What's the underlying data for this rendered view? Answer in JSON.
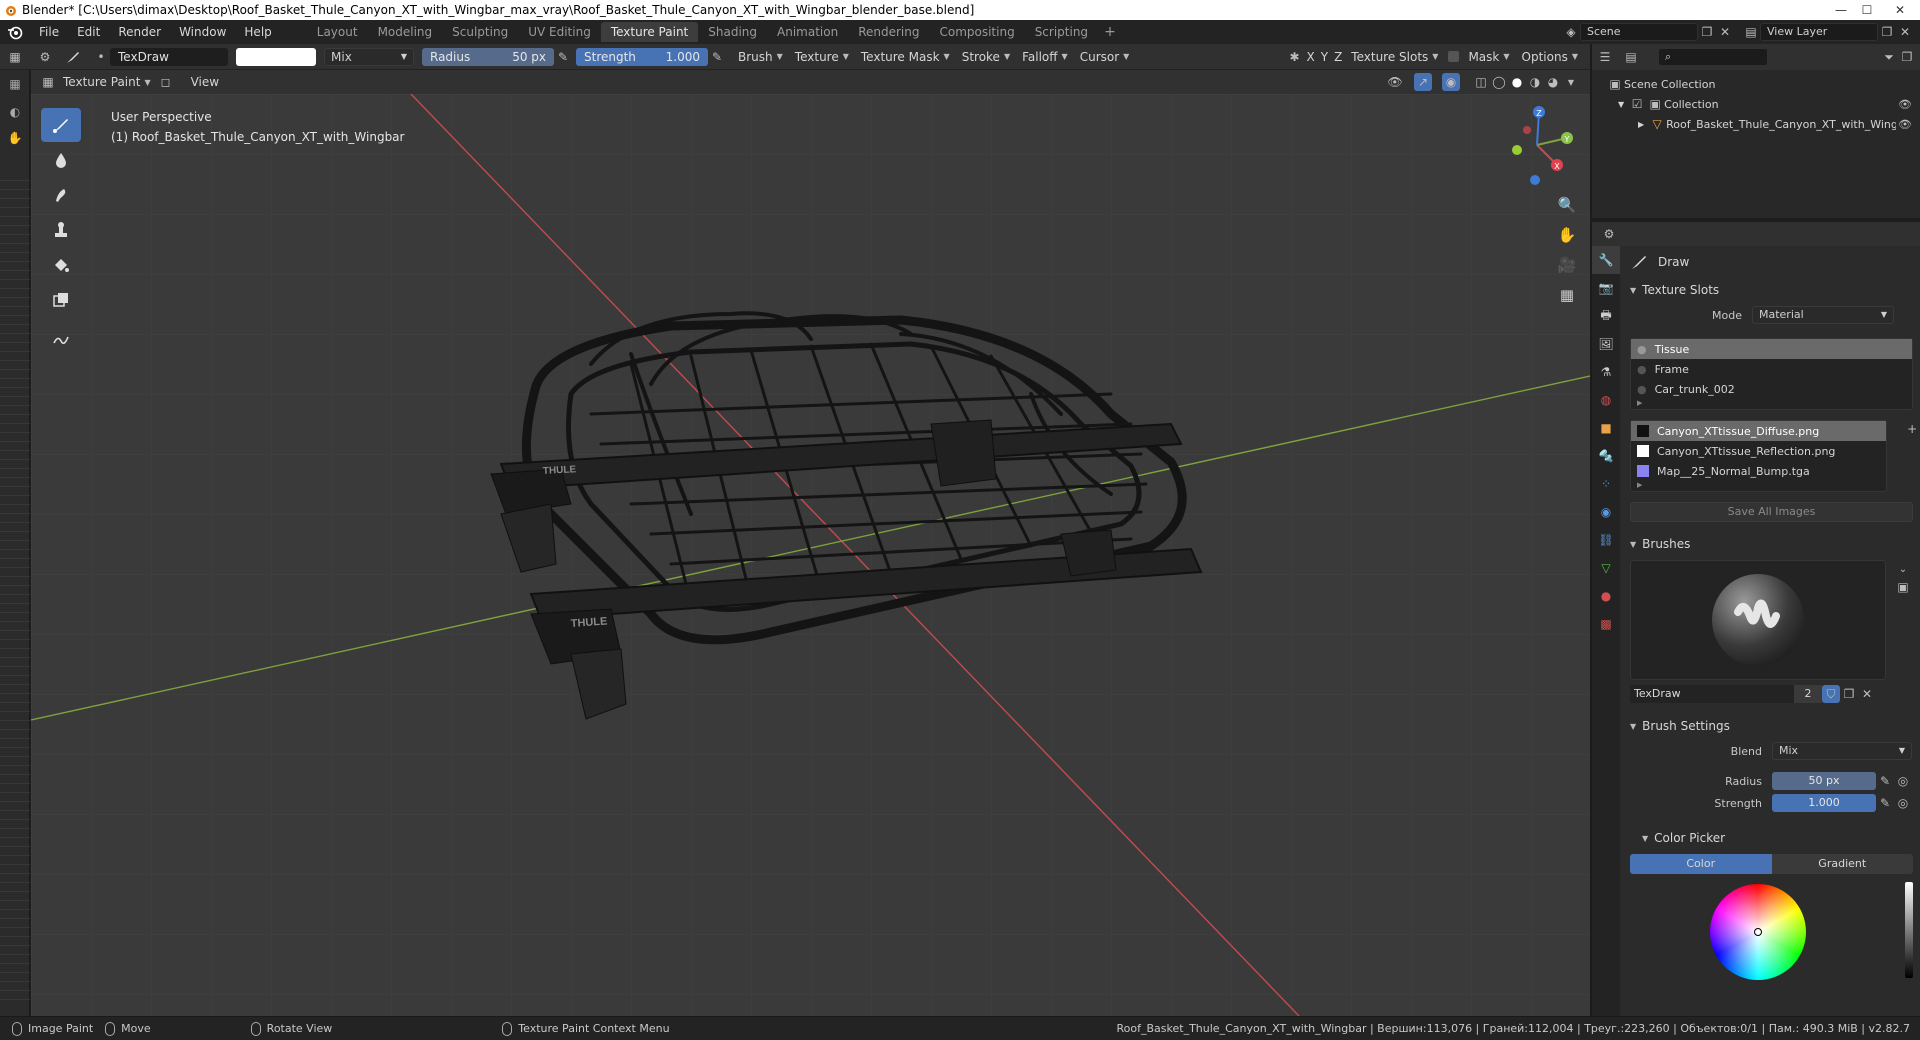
{
  "window": {
    "title": "Blender* [C:\\Users\\dimax\\Desktop\\Roof_Basket_Thule_Canyon_XT_with_Wingbar_max_vray\\Roof_Basket_Thule_Canyon_XT_with_Wingbar_blender_base.blend]",
    "minimize": "—",
    "maximize": "☐",
    "close": "✕"
  },
  "menubar": {
    "menus": [
      "File",
      "Edit",
      "Render",
      "Window",
      "Help"
    ],
    "workspaces": [
      "Layout",
      "Modeling",
      "Sculpting",
      "UV Editing",
      "Texture Paint",
      "Shading",
      "Animation",
      "Rendering",
      "Compositing",
      "Scripting"
    ],
    "active_workspace": "Texture Paint",
    "add_tab": "+",
    "scene": "Scene",
    "view_layer": "View Layer"
  },
  "toolheader": {
    "brush_name": "TexDraw",
    "blend": "Mix",
    "radius_label": "Radius",
    "radius_value": "50 px",
    "strength_label": "Strength",
    "strength_value": "1.000",
    "dropdowns": [
      "Brush",
      "Texture",
      "Texture Mask",
      "Stroke",
      "Falloff",
      "Cursor"
    ],
    "axes": [
      "X",
      "Y",
      "Z"
    ],
    "texture_slots": "Texture Slots",
    "mask": "Mask",
    "options": "Options"
  },
  "viewport": {
    "mode": "Texture Paint",
    "view_menu": "View",
    "perspective": "User Perspective",
    "object_info": "(1) Roof_Basket_Thule_Canyon_XT_with_Wingbar",
    "logo_text": "THULE",
    "gizmo": {
      "x": "X",
      "y": "Y",
      "z": "Z"
    },
    "colors": {
      "background": "#3c3c3c",
      "x_axis": "#c44a4f",
      "y_axis": "#7ea23d",
      "accent": "#4772b3"
    }
  },
  "outliner": {
    "scene_collection": "Scene Collection",
    "collection": "Collection",
    "object": "Roof_Basket_Thule_Canyon_XT_with_Wingbar"
  },
  "properties": {
    "tool_name": "Draw",
    "texture_slots": {
      "title": "Texture Slots",
      "mode_label": "Mode",
      "mode_value": "Material",
      "materials": [
        "Tissue",
        "Frame",
        "Car_trunk_002"
      ],
      "selected_material": "Tissue",
      "images": [
        "Canyon_XTtissue_Diffuse.png",
        "Canyon_XTtissue_Reflection.png",
        "Map__25_Normal_Bump.tga"
      ],
      "selected_image": "Canyon_XTtissue_Diffuse.png",
      "save_all": "Save All Images"
    },
    "brushes": {
      "title": "Brushes",
      "brush_name": "TexDraw",
      "users": "2"
    },
    "brush_settings": {
      "title": "Brush Settings",
      "blend_label": "Blend",
      "blend_value": "Mix",
      "radius_label": "Radius",
      "radius_value": "50 px",
      "strength_label": "Strength",
      "strength_value": "1.000"
    },
    "color_picker": {
      "title": "Color Picker",
      "tab_color": "Color",
      "tab_gradient": "Gradient"
    }
  },
  "statusbar": {
    "left": [
      "Image Paint",
      "Move",
      "Rotate View",
      "Texture Paint Context Menu"
    ],
    "right": "Roof_Basket_Thule_Canyon_XT_with_Wingbar | Вершин:113,076 | Граней:112,004 | Треуг.:223,260 | Объектов:0/1 | Пам.: 490.3 MiB | v2.82.7"
  }
}
